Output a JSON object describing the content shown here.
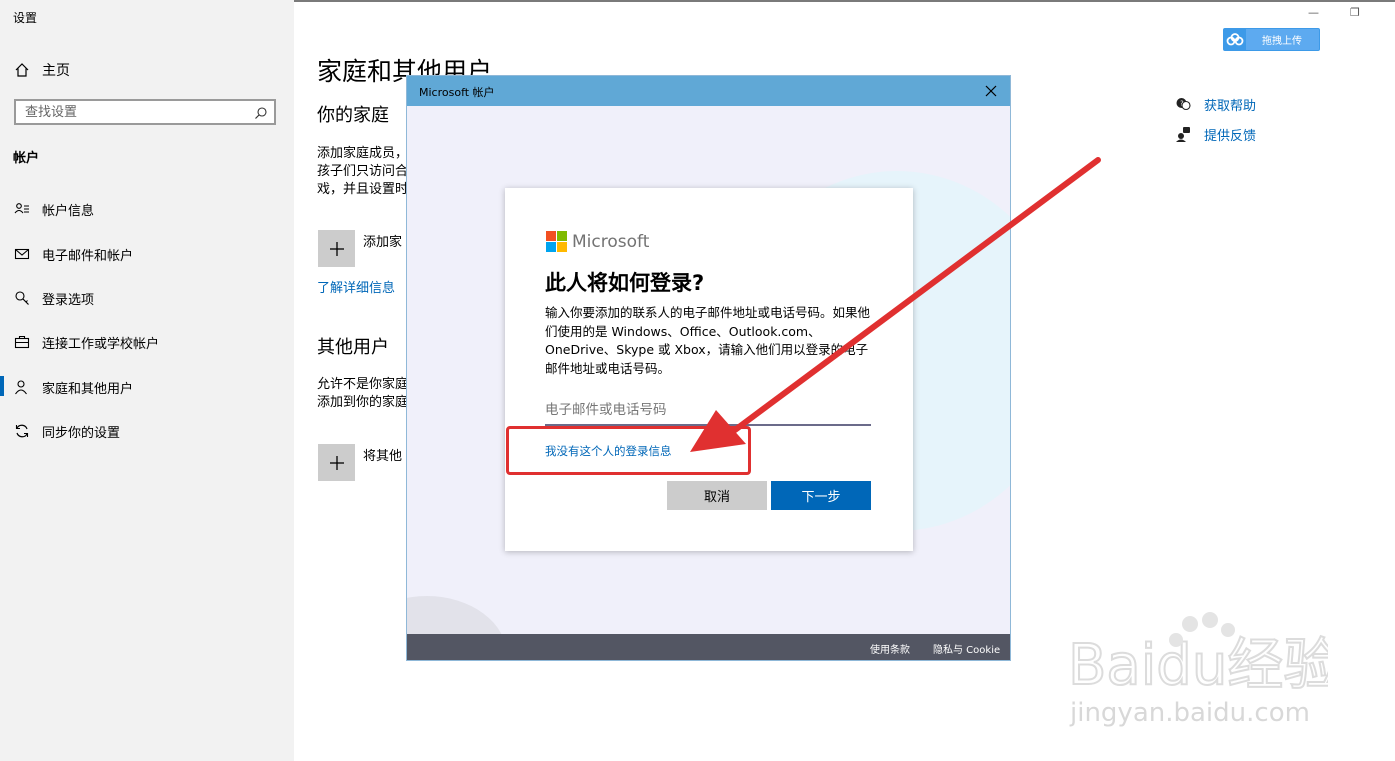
{
  "window": {
    "app_title": "设置",
    "minimize": "—",
    "restore": "❐"
  },
  "sidebar": {
    "home_label": "主页",
    "search_placeholder": "查找设置",
    "section": "帐户",
    "items": [
      {
        "label": "帐户信息",
        "icon": "account-info-icon"
      },
      {
        "label": "电子邮件和帐户",
        "icon": "mail-icon"
      },
      {
        "label": "登录选项",
        "icon": "key-icon"
      },
      {
        "label": "连接工作或学校帐户",
        "icon": "briefcase-icon"
      },
      {
        "label": "家庭和其他用户",
        "icon": "person-icon",
        "active": true
      },
      {
        "label": "同步你的设置",
        "icon": "sync-icon"
      }
    ]
  },
  "main": {
    "title": "家庭和其他用户",
    "family": {
      "heading": "你的家庭",
      "desc": [
        "添加家庭成员，",
        "孩子们只访问合",
        "戏，并且设置时"
      ],
      "add_label": "添加家",
      "learn_more": "了解详细信息"
    },
    "others": {
      "heading": "其他用户",
      "desc": [
        "允许不是你家庭",
        "添加到你的家庭"
      ],
      "add_label": "将其他"
    }
  },
  "help": {
    "get_help": "获取帮助",
    "feedback": "提供反馈"
  },
  "upload_button": {
    "label": "拖拽上传"
  },
  "dialog": {
    "title": "Microsoft 帐户",
    "brand": "Microsoft",
    "heading": "此人将如何登录?",
    "description": "输入你要添加的联系人的电子邮件地址或电话号码。如果他们使用的是 Windows、Office、Outlook.com、OneDrive、Skype 或 Xbox，请输入他们用以登录的电子邮件地址或电话号码。",
    "email_placeholder": "电子邮件或电话号码",
    "no_info_link": "我没有这个人的登录信息",
    "cancel": "取消",
    "next": "下一步",
    "footer": {
      "terms": "使用条款",
      "privacy": "隐私与 Cookie"
    }
  },
  "watermark": {
    "text": "jingyan.baidu.com",
    "logo_text": "Baidu经验"
  },
  "colors": {
    "accent": "#0067b8",
    "annotation": "#e03030",
    "dialog_titlebar": "#60a8d6"
  }
}
